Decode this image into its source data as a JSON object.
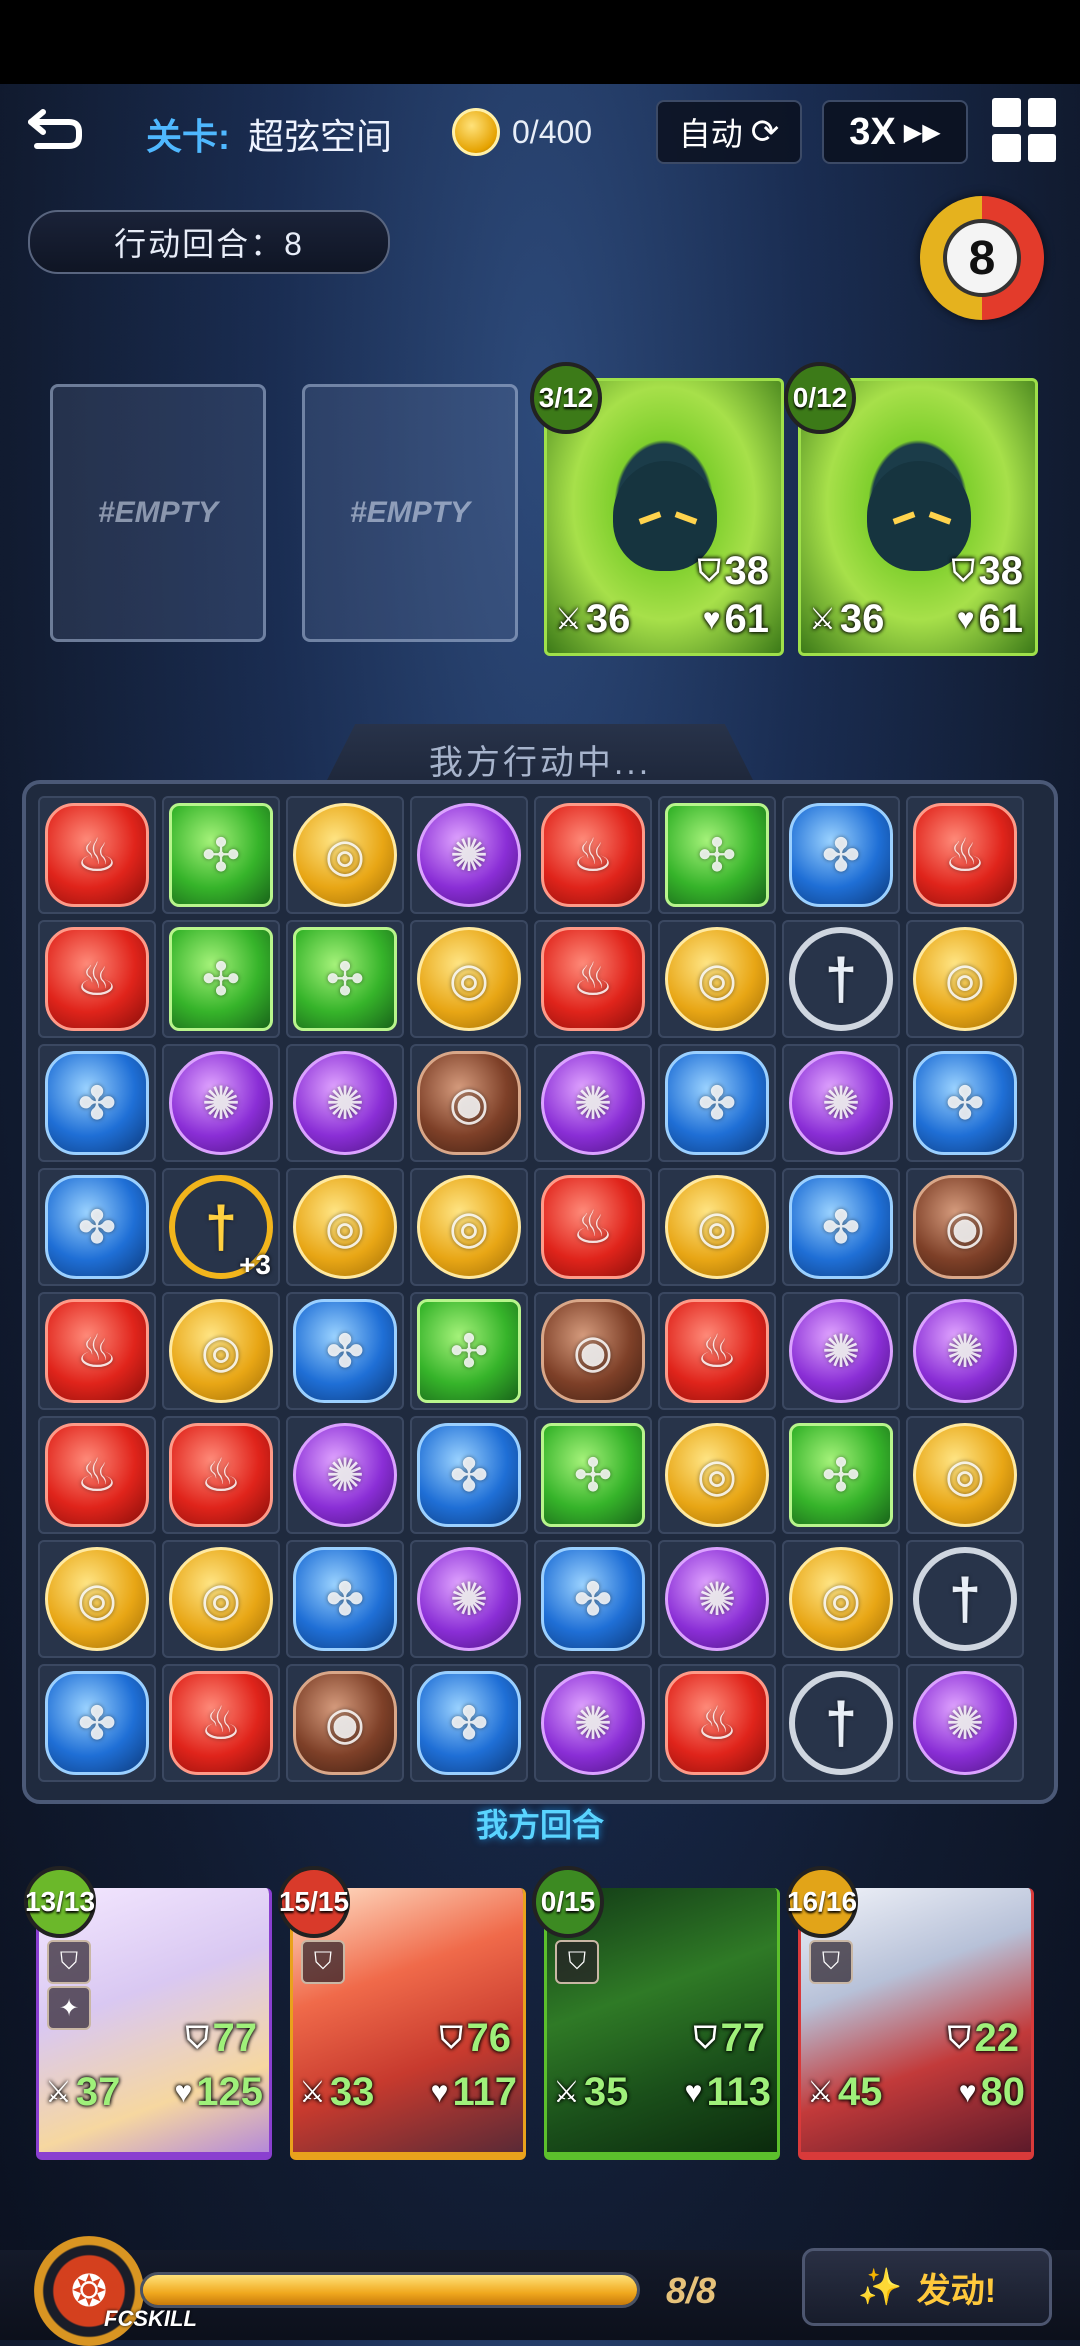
{
  "header": {
    "back_label": "⮌",
    "level_prefix": "关卡:",
    "level_name": "超弦空间",
    "coins": "0/400",
    "auto_label": "自动",
    "speed_label": "3X",
    "turn_counter": "行动回合：8",
    "turn_dial_value": "8"
  },
  "enemies": {
    "empty_label": "#EMPTY",
    "cards": [
      {
        "charge": "3/12",
        "defense": "38",
        "attack": "36",
        "hp": "61",
        "color": "#7fcf2d"
      },
      {
        "charge": "0/12",
        "defense": "38",
        "attack": "36",
        "hp": "61",
        "color": "#7fcf2d"
      }
    ]
  },
  "board": {
    "status_label": "我方行动中...",
    "phase_label": "我方回合",
    "gem_types": {
      "R": {
        "name": "fire-gem",
        "class": "g-red",
        "glyph": "♨"
      },
      "G": {
        "name": "nature-gem",
        "class": "g-green",
        "glyph": "✣"
      },
      "Y": {
        "name": "light-gem",
        "class": "g-gold",
        "glyph": "◎"
      },
      "P": {
        "name": "dark-gem",
        "class": "g-purple",
        "glyph": "✺"
      },
      "B": {
        "name": "water-gem",
        "class": "g-blue",
        "glyph": "✤"
      },
      "N": {
        "name": "earth-gem",
        "class": "g-brown",
        "glyph": "◉"
      },
      "S": {
        "name": "sword-gem",
        "class": "g-silver",
        "glyph": "†"
      },
      "T": {
        "name": "gold-sword-gem",
        "class": "g-goldsword",
        "glyph": "†"
      }
    },
    "rows": [
      [
        "R",
        "G",
        "Y",
        "P",
        "R",
        "G",
        "B",
        "R"
      ],
      [
        "R",
        "G",
        "G",
        "Y",
        "R",
        "Y",
        "S",
        "Y"
      ],
      [
        "B",
        "P",
        "P",
        "N",
        "P",
        "B",
        "P",
        "B"
      ],
      [
        "B",
        "T",
        "Y",
        "Y",
        "R",
        "Y",
        "B",
        "N"
      ],
      [
        "R",
        "Y",
        "B",
        "G",
        "N",
        "R",
        "P",
        "P"
      ],
      [
        "R",
        "R",
        "P",
        "B",
        "G",
        "Y",
        "G",
        "Y"
      ],
      [
        "Y",
        "Y",
        "B",
        "P",
        "B",
        "P",
        "Y",
        "S"
      ],
      [
        "B",
        "R",
        "N",
        "B",
        "P",
        "R",
        "S",
        "P"
      ]
    ],
    "special_bonus": "+3"
  },
  "heroes": [
    {
      "charge": "13/13",
      "defense": "77",
      "attack": "37",
      "hp": "125",
      "color": "#8a3fd0",
      "badge": "#6bb82a"
    },
    {
      "charge": "15/15",
      "defense": "76",
      "attack": "33",
      "hp": "117",
      "color": "#e9a21c",
      "badge": "#d93a2a"
    },
    {
      "charge": "0/15",
      "defense": "77",
      "attack": "35",
      "hp": "113",
      "color": "#5cc02c",
      "badge": "#3c8a22"
    },
    {
      "charge": "16/16",
      "defense": "22",
      "attack": "45",
      "hp": "80",
      "color": "#d93a3a",
      "badge": "#e2a418"
    }
  ],
  "fcskill": {
    "label": "FCSKILL",
    "count": "8/8",
    "progress": 1.0,
    "activate_label": "发动!"
  }
}
